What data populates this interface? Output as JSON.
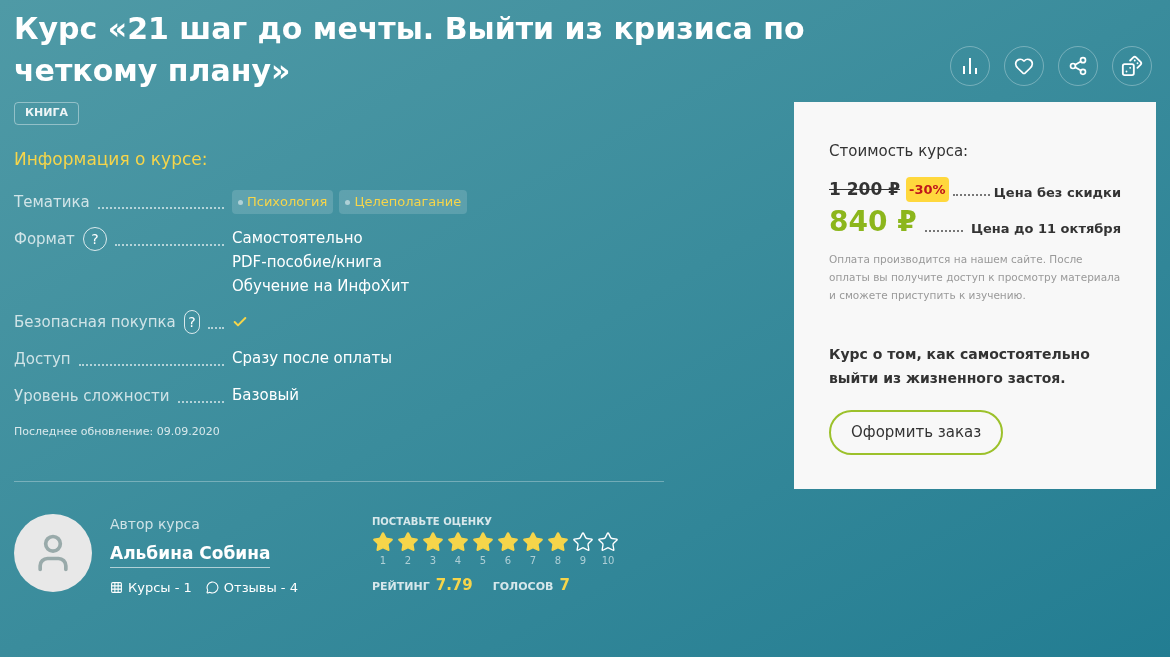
{
  "title": "Курс «21 шаг до мечты. Выйти из кризиса по четкому плану»",
  "actions": [
    {
      "kind": "stats"
    },
    {
      "kind": "favorite"
    },
    {
      "kind": "share"
    },
    {
      "kind": "random"
    }
  ],
  "badge": "КНИГА",
  "info": {
    "heading": "Информация о курсе:",
    "rows": [
      {
        "label": "Тематика",
        "kind": "tags",
        "values": [
          "Психология",
          "Целеполагание"
        ]
      },
      {
        "label": "Формат",
        "help": "?",
        "kind": "lines",
        "values": [
          "Самостоятельно",
          "PDF-пособие/книга",
          "Обучение на ИнфоХит"
        ]
      },
      {
        "label": "Безопасная покупка",
        "help": "?",
        "kind": "check",
        "checked": true
      },
      {
        "label": "Доступ",
        "kind": "lines",
        "values": [
          "Сразу после оплаты"
        ]
      },
      {
        "label": "Уровень сложности",
        "kind": "lines",
        "values": [
          "Базовый"
        ]
      }
    ],
    "updated": "Последнее обновление: 09.09.2020"
  },
  "author": {
    "caption": "Автор курса",
    "name": "Альбина Собина",
    "courses": "Курсы - 1",
    "reviews": "Отзывы - 4"
  },
  "rating": {
    "prompt": "ПОСТАВЬТЕ ОЦЕНКУ",
    "stars": 8,
    "numbers": [
      "1",
      "2",
      "3",
      "4",
      "5",
      "6",
      "7",
      "8",
      "9",
      "10"
    ],
    "rating_label": "РЕЙТИНГ",
    "rating_value": "7.79",
    "votes_label": "ГОЛОСОВ",
    "votes_value": "7"
  },
  "price": {
    "heading": "Стоимость курса:",
    "old_price": "1 200 ₽",
    "discount": "-30%",
    "old_label": "Цена без скидки",
    "new_price": "840 ₽",
    "new_label": "Цена до 11 октября",
    "note": "Оплата производится на нашем сайте. После оплаты вы получите доступ к просмотру материала и сможете приступить к изучению.",
    "summary": "Курс о том, как самостоятельно выйти из жизненного застоя.",
    "button": "Оформить заказ"
  }
}
